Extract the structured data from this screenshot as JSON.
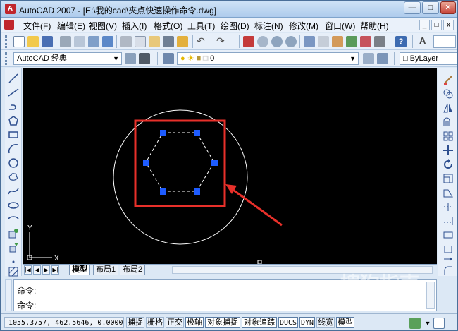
{
  "window": {
    "title": "AutoCAD 2007 - [E:\\我的cad\\夹点快速操作命令.dwg]",
    "app_icon": "A",
    "minimize": "—",
    "maximize": "□",
    "close": "✕"
  },
  "menu": [
    "文件(F)",
    "编辑(E)",
    "视图(V)",
    "插入(I)",
    "格式(O)",
    "工具(T)",
    "绘图(D)",
    "标注(N)",
    "修改(M)",
    "窗口(W)",
    "帮助(H)"
  ],
  "mdi_controls": [
    "_",
    "□",
    "x"
  ],
  "toolbar2": {
    "workspace": "AutoCAD 经典",
    "layer": "0",
    "color": "ByLayer"
  },
  "canvas": {
    "ucs_y": "Y",
    "ucs_x": "X"
  },
  "layout_tabs": {
    "nav": [
      "|◀",
      "◀",
      "▶",
      "▶|"
    ],
    "tabs": [
      "模型",
      "布局1",
      "布局2"
    ],
    "active": "模型"
  },
  "command": {
    "line1": "命令:",
    "line2": "命令:"
  },
  "status": {
    "coords": "1055.3757, 462.5646, 0.0000",
    "buttons": [
      "捕捉",
      "栅格",
      "正交",
      "极轴",
      "对象捕捉",
      "对象追踪",
      "DUCS",
      "DYN",
      "线宽",
      "模型"
    ]
  },
  "watermark": {
    "main": "搜狗指南",
    "sub": "zhinan.sogou.com"
  },
  "colors": {
    "canvas": "#000000",
    "grip": "#1e5cff",
    "highlight": "#e8302a",
    "circle": "#ffffff"
  }
}
